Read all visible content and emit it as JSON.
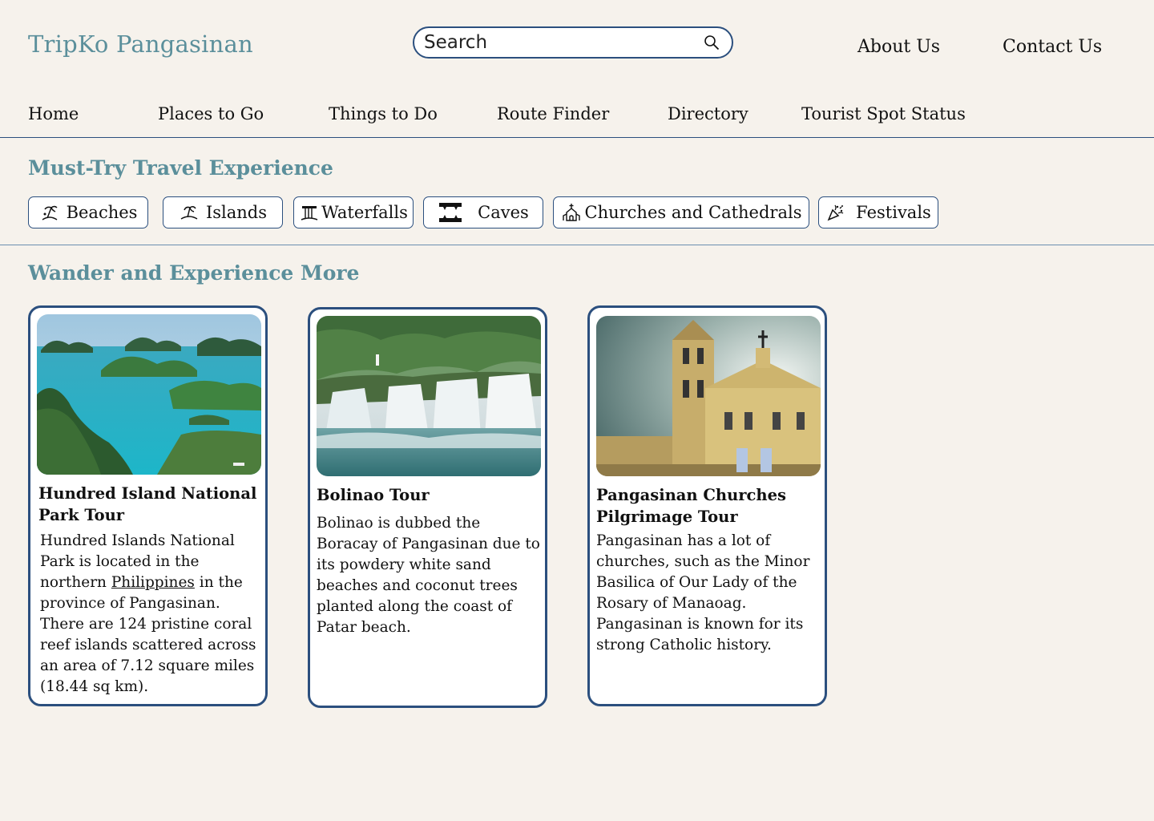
{
  "header": {
    "brand": "TripKo Pangasinan",
    "search_placeholder": "Search",
    "about": "About Us",
    "contact": "Contact Us"
  },
  "nav": {
    "home": "Home",
    "places": "Places to Go",
    "things": "Things to Do",
    "route": "Route Finder",
    "directory": "Directory",
    "status": "Tourist Spot Status"
  },
  "must_try": {
    "title": "Must-Try Travel Experience",
    "chips": [
      {
        "label": "Beaches",
        "icon": "beach-icon"
      },
      {
        "label": "Islands",
        "icon": "island-icon"
      },
      {
        "label": "Waterfalls",
        "icon": "waterfall-icon"
      },
      {
        "label": "Caves",
        "icon": "cave-icon"
      },
      {
        "label": "Churches and Cathedrals",
        "icon": "church-icon"
      },
      {
        "label": "Festivals",
        "icon": "party-popper-icon"
      }
    ]
  },
  "wander": {
    "title": "Wander and Experience More",
    "cards": [
      {
        "title": "Hundred Island National Park Tour",
        "desc_before": "Hundred Islands National Park is located in the northern ",
        "link": "Philippines",
        "desc_after": " in the province of Pangasinan. There are 124 pristine coral reef islands scattered across an area of 7.12 square miles (18.44 sq km)."
      },
      {
        "title": "Bolinao Tour",
        "desc": "Bolinao is dubbed the Boracay of Pangasinan due to its powdery white sand beaches and coconut trees planted along the coast of Patar beach."
      },
      {
        "title": "Pangasinan Churches Pilgrimage Tour",
        "desc": "Pangasinan has a lot of churches, such as the Minor Basilica of Our Lady  of the Rosary of Manaoag. Pangasinan is known for its strong Catholic history."
      }
    ]
  },
  "colors": {
    "accent": "#5b8f9b",
    "border": "#2b4f7e",
    "background": "#f6f2ec"
  }
}
